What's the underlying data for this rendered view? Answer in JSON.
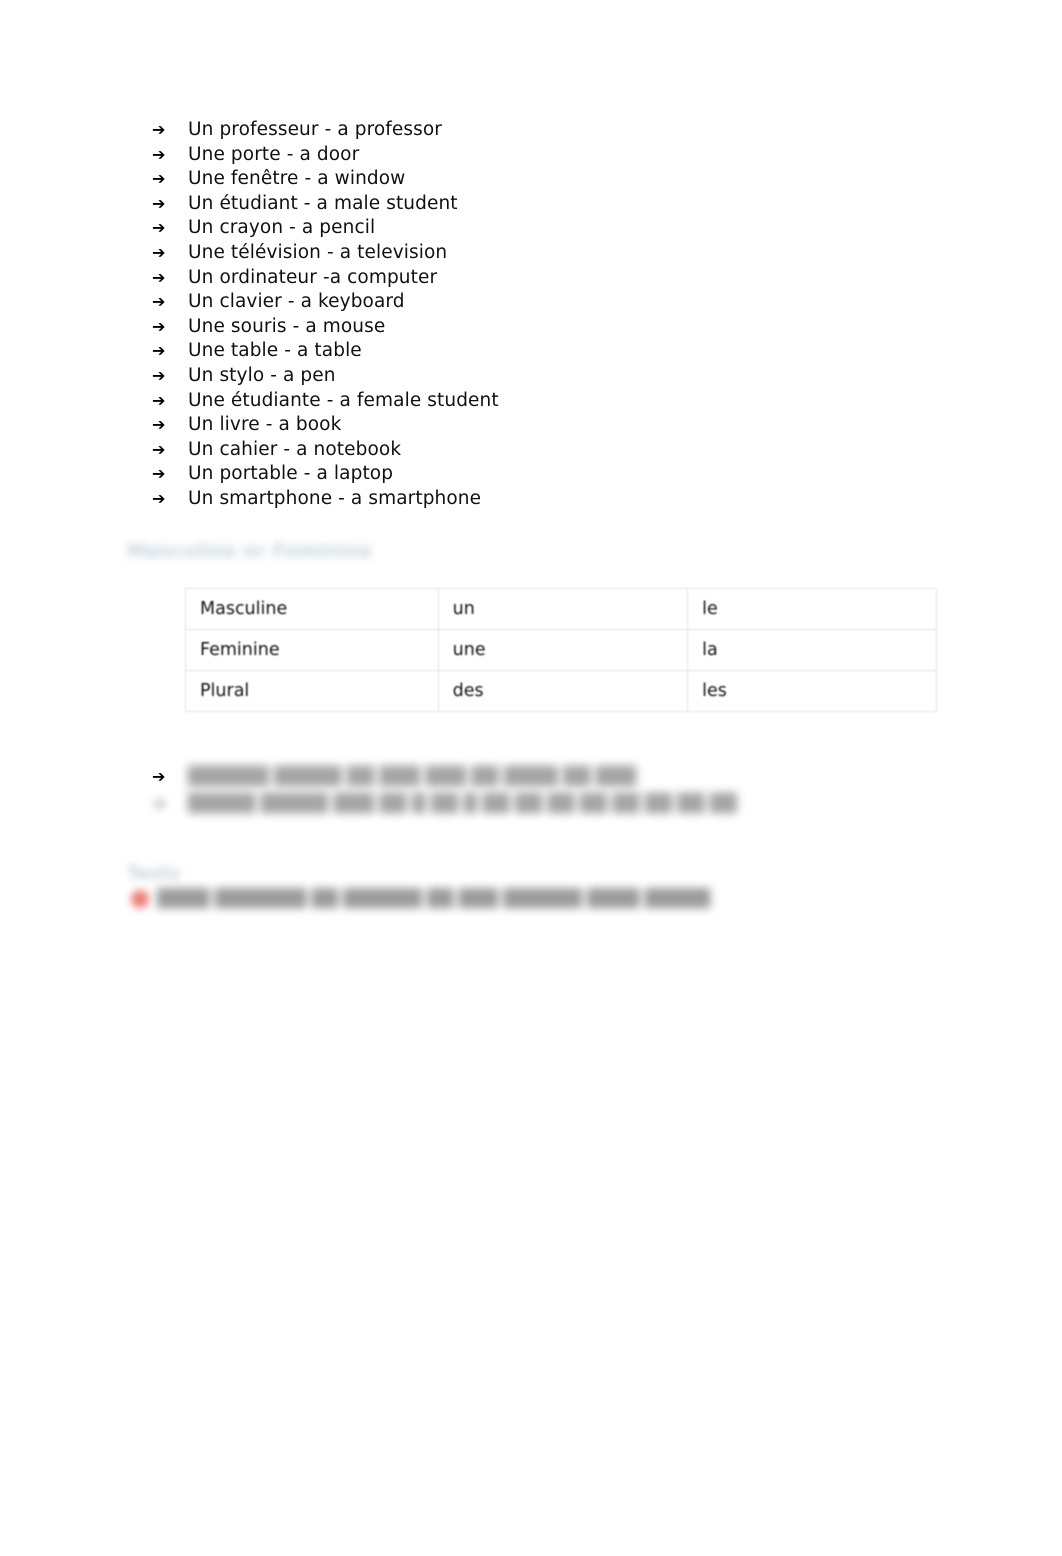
{
  "document": {
    "background_color": "#ffffff",
    "text_color": "#101010",
    "heading_color": "#b9cbd8",
    "accent_red": "#e8524a",
    "table_border_color": "#e3e3e3"
  },
  "vocabulary": {
    "bullet_glyph": "➔",
    "items": [
      {
        "french": "Un professeur",
        "english": "a professor",
        "line": "Un professeur - a professor"
      },
      {
        "french": "Une porte",
        "english": "a door",
        "line": "Une porte - a door"
      },
      {
        "french": "Une fenêtre",
        "english": "a window",
        "line": "Une fenêtre - a window"
      },
      {
        "french": "Un étudiant",
        "english": "a male student",
        "line": "Un étudiant - a male student"
      },
      {
        "french": "Un crayon",
        "english": "a pencil",
        "line": "Un crayon - a pencil"
      },
      {
        "french": "Une télévision",
        "english": "a television",
        "line": "Une télévision - a television"
      },
      {
        "french": "Un ordinateur",
        "english": "a computer",
        "line": "Un ordinateur -a computer"
      },
      {
        "french": "Un clavier",
        "english": "a keyboard",
        "line": "Un clavier - a keyboard"
      },
      {
        "french": "Une souris",
        "english": "a mouse",
        "line": "Une souris - a mouse"
      },
      {
        "french": "Une table",
        "english": "a table",
        "line": "Une table - a table"
      },
      {
        "french": "Un stylo",
        "english": "a pen",
        "line": "Un stylo - a pen"
      },
      {
        "french": "Une étudiante",
        "english": "a female student",
        "line": "Une étudiante - a female student"
      },
      {
        "french": "Un livre",
        "english": "a book",
        "line": "Un livre - a book"
      },
      {
        "french": "Un cahier",
        "english": "a notebook",
        "line": "Un cahier - a notebook"
      },
      {
        "french": "Un portable",
        "english": "a laptop",
        "line": "Un portable - a laptop"
      },
      {
        "french": "Un smartphone",
        "english": "a smartphone",
        "line": "Un smartphone - a smartphone"
      }
    ]
  },
  "gender_section": {
    "heading": "Masculine or Feminine",
    "heading_redacted": true,
    "table": {
      "rows": [
        {
          "gender": "Masculine",
          "indefinite": "un",
          "definite": "le"
        },
        {
          "gender": "Feminine",
          "indefinite": "une",
          "definite": "la"
        },
        {
          "gender": "Plural",
          "indefinite": "des",
          "definite": "les"
        }
      ]
    }
  },
  "notes": {
    "bullet_glyph": "➔",
    "items": [
      {
        "text": "██████ █████  ██  ███  ███  ██  ████  ██ ███",
        "redacted": true
      },
      {
        "text": "█████ █████  ███  ██  █  ██  █  ██  ██  ██  ██  ██  ██  ██ ██",
        "redacted": true
      }
    ]
  },
  "alert": {
    "heading": "Tests",
    "heading_redacted": true,
    "bullet_color": "#e8524a",
    "text": "████ ███████ ██ ██████ ██ ███ ██████ ████ █████",
    "redacted": true
  }
}
